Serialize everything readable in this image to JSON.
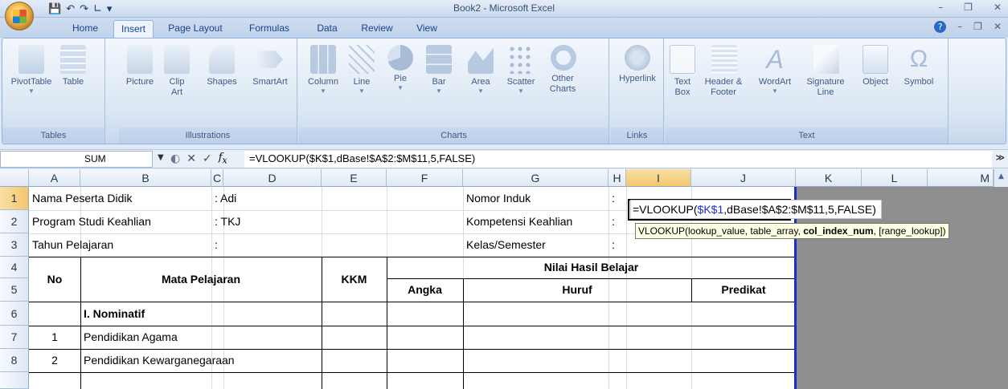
{
  "window": {
    "title": "Book2 - Microsoft Excel"
  },
  "ribbon_tabs": [
    "Home",
    "Insert",
    "Page Layout",
    "Formulas",
    "Data",
    "Review",
    "View"
  ],
  "active_tab": "Insert",
  "ribbon": {
    "tables": {
      "label": "Tables",
      "buttons": [
        "PivotTable",
        "Table"
      ]
    },
    "illustrations": {
      "label": "Illustrations",
      "buttons": [
        "Picture",
        "Clip Art",
        "Shapes",
        "SmartArt"
      ]
    },
    "charts": {
      "label": "Charts",
      "buttons": [
        "Column",
        "Line",
        "Pie",
        "Bar",
        "Area",
        "Scatter",
        "Other Charts"
      ]
    },
    "links": {
      "label": "Links",
      "buttons": [
        "Hyperlink"
      ]
    },
    "text": {
      "label": "Text",
      "buttons": [
        "Text Box",
        "Header & Footer",
        "WordArt",
        "Signature Line",
        "Object",
        "Symbol"
      ]
    }
  },
  "formula_bar": {
    "name_box": "SUM",
    "formula": "=VLOOKUP($K$1,dBase!$A$2:$M$11,5,FALSE)"
  },
  "columns": [
    "A",
    "B",
    "C",
    "D",
    "E",
    "F",
    "G",
    "H",
    "I",
    "J",
    "K",
    "L",
    "M"
  ],
  "rows": [
    "1",
    "2",
    "3",
    "4",
    "5",
    "6",
    "7",
    "8"
  ],
  "cells": {
    "b1": "Nama Peserta Didik",
    "c1": ": Adi",
    "g1": "Nomor Induk",
    "h1": ":",
    "b2": "Program Studi Keahlian",
    "c2": ": TKJ",
    "g2": "Kompetensi Keahlian",
    "h2": ":",
    "b3": "Tahun Pelajaran",
    "c3": ":",
    "g3": "Kelas/Semester",
    "h3": ":",
    "a4": "No",
    "b4": "Mata Pelajaran",
    "e4": "KKM",
    "f4": "Nilai Hasil Belajar",
    "f5": "Angka",
    "g5": "Huruf",
    "j5": "Predikat",
    "b6": "I. Nominatif",
    "a7": "1",
    "b7": "Pendidikan Agama",
    "a8": "2",
    "b8": "Pendidikan Kewarganegaraan"
  },
  "edit": {
    "prefix": "=VLOOKUP(",
    "ref": "$K$1",
    "suffix": ",dBase!$A$2:$M$11,5,FALSE)"
  },
  "tooltip": {
    "fn": "VLOOKUP(",
    "arg1": "lookup_value, table_array, ",
    "arg_bold": "col_index_num",
    "arg_end": ", [range_lookup])"
  },
  "colors": {
    "reference_blue": "#1f2dc2",
    "active_header": "#f3c76b"
  }
}
